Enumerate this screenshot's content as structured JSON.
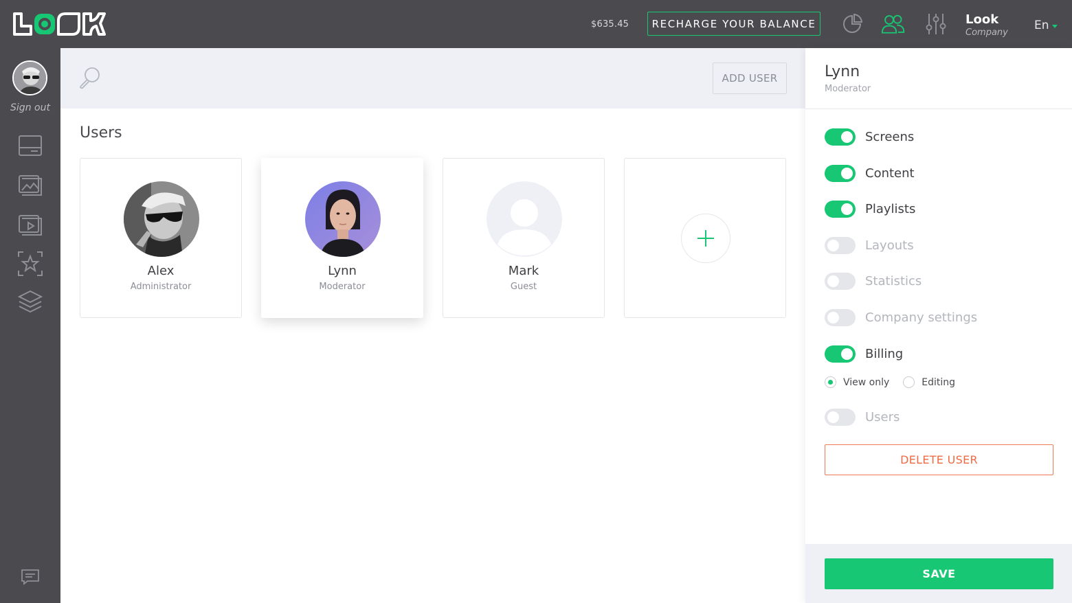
{
  "brand": {
    "logo_text": "LOOK",
    "accent": "#17c773",
    "dark": "#4a4a4f",
    "danger": "#ef6a42"
  },
  "topbar": {
    "balance": "$635.45",
    "recharge_label": "RECHARGE YOUR BALANCE",
    "icons": [
      "pie-chart-icon",
      "users-icon",
      "sliders-icon"
    ],
    "company_name": "Look",
    "company_sub": "Company",
    "language": "En"
  },
  "sidebar": {
    "signout_label": "Sign out",
    "icons": [
      "screens-icon",
      "content-icon",
      "playlists-icon",
      "layouts-icon",
      "layers-icon",
      "chat-icon"
    ]
  },
  "search": {
    "icon": "search-icon",
    "add_user_label": "ADD USER"
  },
  "main": {
    "title": "Users",
    "users": [
      {
        "name": "Alex",
        "role": "Administrator",
        "avatar": "photo-bw"
      },
      {
        "name": "Lynn",
        "role": "Moderator",
        "avatar": "photo-violet",
        "selected": true
      },
      {
        "name": "Mark",
        "role": "Guest",
        "avatar": "placeholder"
      }
    ],
    "add_card_icon": "plus-icon"
  },
  "panel": {
    "name": "Lynn",
    "role": "Moderator",
    "permissions": [
      {
        "label": "Screens",
        "on": true
      },
      {
        "label": "Content",
        "on": true
      },
      {
        "label": "Playlists",
        "on": true
      },
      {
        "label": "Layouts",
        "on": false
      },
      {
        "label": "Statistics",
        "on": false
      },
      {
        "label": "Company settings",
        "on": false
      },
      {
        "label": "Billing",
        "on": true
      },
      {
        "label": "Users",
        "on": false
      }
    ],
    "billing_access": {
      "options": [
        "View only",
        "Editing"
      ],
      "selected": "View only"
    },
    "delete_label": "DELETE USER",
    "save_label": "SAVE"
  }
}
